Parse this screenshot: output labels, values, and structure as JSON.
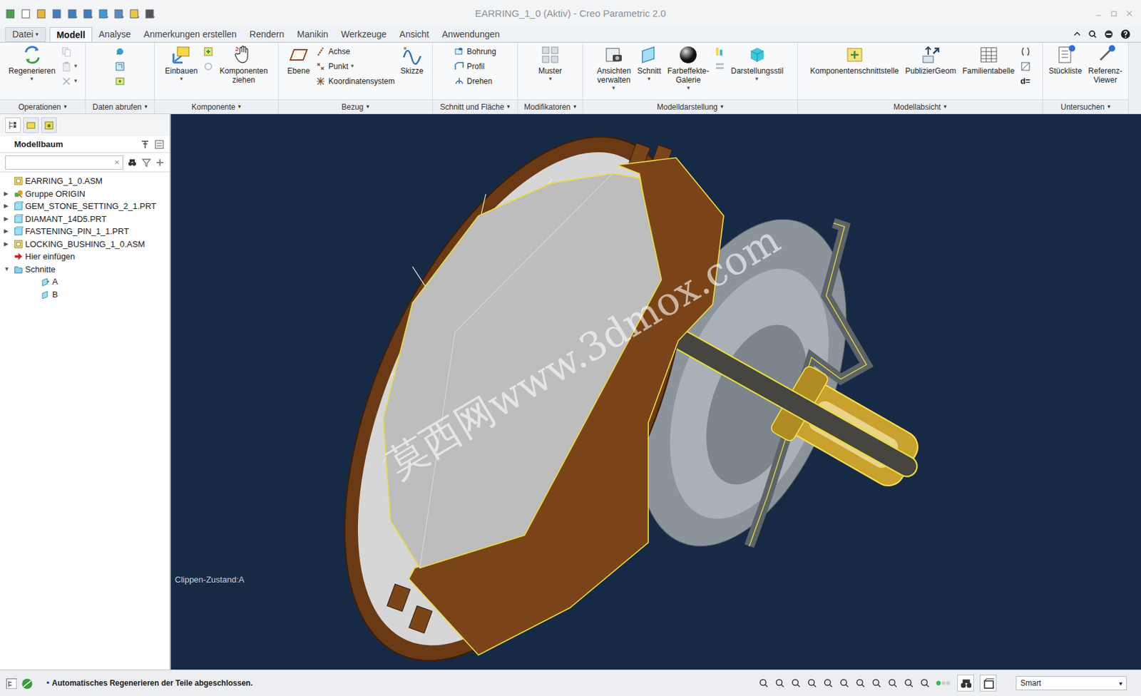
{
  "window": {
    "title": "EARRING_1_0 (Aktiv) - Creo Parametric 2.0"
  },
  "tabs": [
    {
      "label": "Datei",
      "selected": false,
      "dropdown": "▾"
    },
    {
      "label": "Modell",
      "selected": true
    },
    {
      "label": "Analyse",
      "selected": false
    },
    {
      "label": "Anmerkungen erstellen",
      "selected": false
    },
    {
      "label": "Rendern",
      "selected": false
    },
    {
      "label": "Manikin",
      "selected": false
    },
    {
      "label": "Werkzeuge",
      "selected": false
    },
    {
      "label": "Ansicht",
      "selected": false
    },
    {
      "label": "Anwendungen",
      "selected": false
    }
  ],
  "ribbon": {
    "groups": [
      {
        "label": "Operationen",
        "arrow": "▾",
        "items": [
          {
            "kind": "large",
            "lines": [
              "Regenerieren"
            ],
            "dropdown": "▾"
          },
          {
            "kind": "column",
            "items": [
              {
                "kind": "icon",
                "disabled": true
              },
              {
                "kind": "icon",
                "disabled": true,
                "dropdown": "▾"
              },
              {
                "kind": "icon",
                "disabled": true,
                "dropdown": "▾"
              }
            ]
          }
        ]
      },
      {
        "label": "Daten abrufen",
        "arrow": "▾",
        "items": [
          {
            "kind": "column",
            "items": [
              {
                "kind": "icon",
                "disabled": false
              },
              {
                "kind": "icon",
                "disabled": false
              },
              {
                "kind": "icon",
                "disabled": false
              }
            ]
          }
        ]
      },
      {
        "label": "Komponente",
        "arrow": "▾",
        "items": [
          {
            "kind": "large",
            "lines": [
              "Einbauen"
            ],
            "dropdown": "▾"
          },
          {
            "kind": "column",
            "items": [
              {
                "kind": "icon",
                "disabled": false
              },
              {
                "kind": "icon",
                "disabled": true
              }
            ]
          },
          {
            "kind": "large",
            "lines": [
              "Komponenten",
              "ziehen"
            ]
          }
        ]
      },
      {
        "label": "Bezug",
        "arrow": "▾",
        "items": [
          {
            "kind": "large",
            "lines": [
              "Ebene"
            ]
          },
          {
            "kind": "column",
            "items": [
              {
                "kind": "small",
                "label": "Achse",
                "disabled": false
              },
              {
                "kind": "small",
                "label": "Punkt",
                "disabled": false,
                "dropdown": "▾"
              },
              {
                "kind": "small",
                "label": "Koordinatensystem",
                "disabled": false
              }
            ]
          },
          {
            "kind": "large",
            "lines": [
              "Skizze"
            ]
          }
        ]
      },
      {
        "label": "Schnitt und Fläche",
        "arrow": "▾",
        "items": [
          {
            "kind": "column",
            "items": [
              {
                "kind": "small",
                "label": "Bohrung",
                "disabled": false
              },
              {
                "kind": "small",
                "label": "Profil",
                "disabled": false
              },
              {
                "kind": "small",
                "label": "Drehen",
                "disabled": false
              }
            ]
          }
        ]
      },
      {
        "label": "Modifikatoren",
        "arrow": "▾",
        "items": [
          {
            "kind": "large",
            "lines": [
              "Muster"
            ],
            "dropdown": "▾"
          }
        ]
      },
      {
        "label": "Modelldarstellung",
        "arrow": "▾",
        "items": [
          {
            "kind": "large",
            "lines": [
              "Ansichten",
              "verwalten"
            ],
            "dropdown": "▾"
          },
          {
            "kind": "large",
            "lines": [
              "Schnitt"
            ],
            "dropdown": "▾"
          },
          {
            "kind": "large",
            "lines": [
              "Farbeffekte-",
              "Galerie"
            ],
            "dropdown": "▾"
          },
          {
            "kind": "column",
            "items": [
              {
                "kind": "icon",
                "disabled": false
              },
              {
                "kind": "icon",
                "disabled": true
              }
            ]
          },
          {
            "kind": "large",
            "lines": [
              "Darstellungsstil"
            ],
            "dropdown": "▾"
          }
        ]
      },
      {
        "label": "Modellabsicht",
        "arrow": "▾",
        "items": [
          {
            "kind": "large",
            "lines": [
              "Komponentenschnittstelle"
            ]
          },
          {
            "kind": "large",
            "lines": [
              "PublizierGeom"
            ]
          },
          {
            "kind": "large",
            "lines": [
              "Familientabelle"
            ]
          },
          {
            "kind": "column",
            "items": [
              {
                "kind": "icon",
                "disabled": false
              },
              {
                "kind": "icon",
                "disabled": false
              },
              {
                "kind": "glyph",
                "label": "d=",
                "disabled": false
              }
            ]
          }
        ]
      },
      {
        "label": "Untersuchen",
        "arrow": "▾",
        "items": [
          {
            "kind": "large",
            "lines": [
              "Stückliste"
            ]
          },
          {
            "kind": "large",
            "lines": [
              "Referenz-",
              "Viewer"
            ]
          }
        ]
      }
    ]
  },
  "model_tree": {
    "title": "Modellbaum",
    "search": {
      "value": "",
      "clear": "×"
    },
    "items": [
      {
        "label": "EARRING_1_0.ASM",
        "kind": "assembly",
        "depth": 0,
        "expander": "",
        "expanded": false
      },
      {
        "label": "Gruppe ORIGIN",
        "kind": "group",
        "depth": 0,
        "expander": "▶",
        "expanded": false
      },
      {
        "label": "GEM_STONE_SETTING_2_1.PRT",
        "kind": "part",
        "depth": 0,
        "expander": "▶",
        "expanded": false
      },
      {
        "label": "DIAMANT_14D5.PRT",
        "kind": "part",
        "depth": 0,
        "expander": "▶",
        "expanded": false
      },
      {
        "label": "FASTENING_PIN_1_1.PRT",
        "kind": "part",
        "depth": 0,
        "expander": "▶",
        "expanded": false
      },
      {
        "label": "LOCKING_BUSHING_1_0.ASM",
        "kind": "assembly",
        "depth": 0,
        "expander": "▶",
        "expanded": false
      },
      {
        "label": "Hier einfügen",
        "kind": "insert",
        "depth": 0,
        "expander": "",
        "expanded": false
      },
      {
        "label": "Schnitte",
        "kind": "folder",
        "depth": 0,
        "expander": "▼",
        "expanded": true
      },
      {
        "label": "A",
        "kind": "section-active",
        "depth": 2,
        "expander": "",
        "expanded": false
      },
      {
        "label": "B",
        "kind": "section",
        "depth": 2,
        "expander": "",
        "expanded": false
      }
    ]
  },
  "viewport": {
    "watermark": "莫西网www.3dmox.com",
    "clip_state": "Clippen-Zustand:A"
  },
  "status_bar": {
    "bullet": "•",
    "message": "Automatisches Regenerieren der Teile abgeschlossen.",
    "filter": {
      "value": "Smart",
      "arrow": "▾"
    }
  }
}
